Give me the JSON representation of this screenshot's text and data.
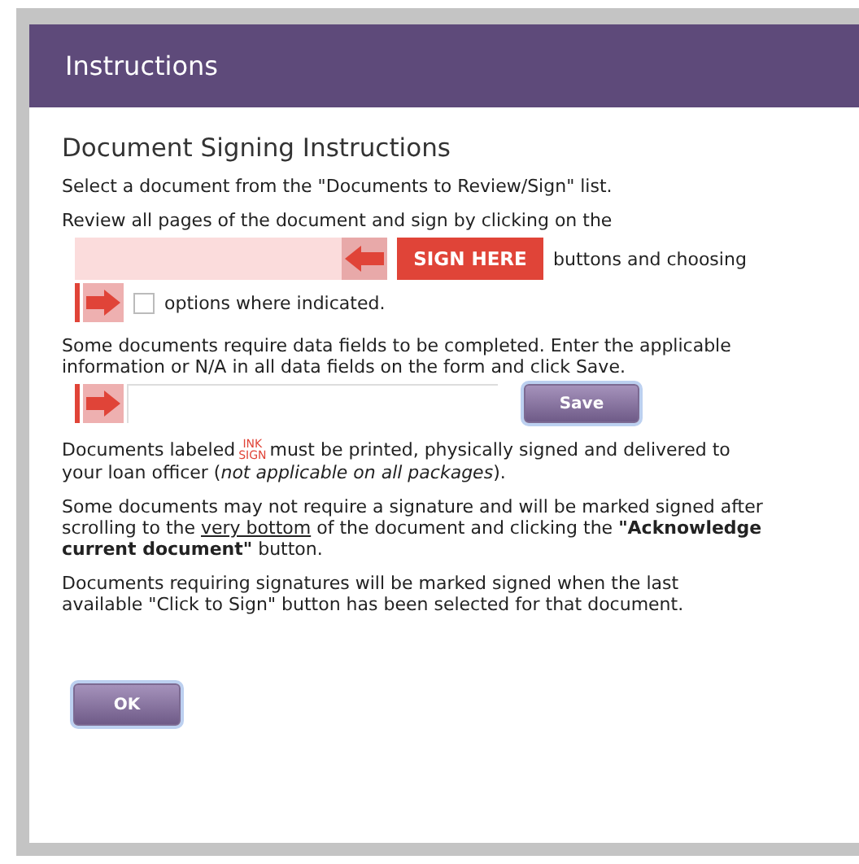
{
  "window": {
    "title": "Instructions"
  },
  "heading": "Document Signing Instructions",
  "intro": "Select a document from the \"Documents to Review/Sign\" list.",
  "review_text": "Review all pages of the document and sign by clicking on the",
  "sign_button": "SIGN HERE",
  "sign_tail": "buttons and choosing",
  "option_checkbox": {
    "checked": false
  },
  "option_text": "options where indicated.",
  "data_fields_text": "Some documents require data fields to be completed. Enter the applicable information or N/A in all data fields on the form and click Save.",
  "save_button": "Save",
  "ink_paragraph": {
    "before": "Documents labeled",
    "badge_top": "INK",
    "badge_bottom": "SIGN",
    "after": "must be printed, physically signed and delivered to your loan officer (*not applicable on all packages*)."
  },
  "acknowledge_paragraph": [
    {
      "kind": "plain",
      "text": "Some documents may not require a signature and will be marked signed after scrolling to the "
    },
    {
      "kind": "underline",
      "text": "very bottom"
    },
    {
      "kind": "plain",
      "text": " of the document and clicking the "
    },
    {
      "kind": "bold",
      "text": "\"Acknowledge current document\""
    },
    {
      "kind": "plain",
      "text": " button."
    }
  ],
  "final_text": "Documents requiring signatures will be marked signed when the last available \"Click to Sign\" button has been selected for that document.",
  "ok_button": "OK"
}
